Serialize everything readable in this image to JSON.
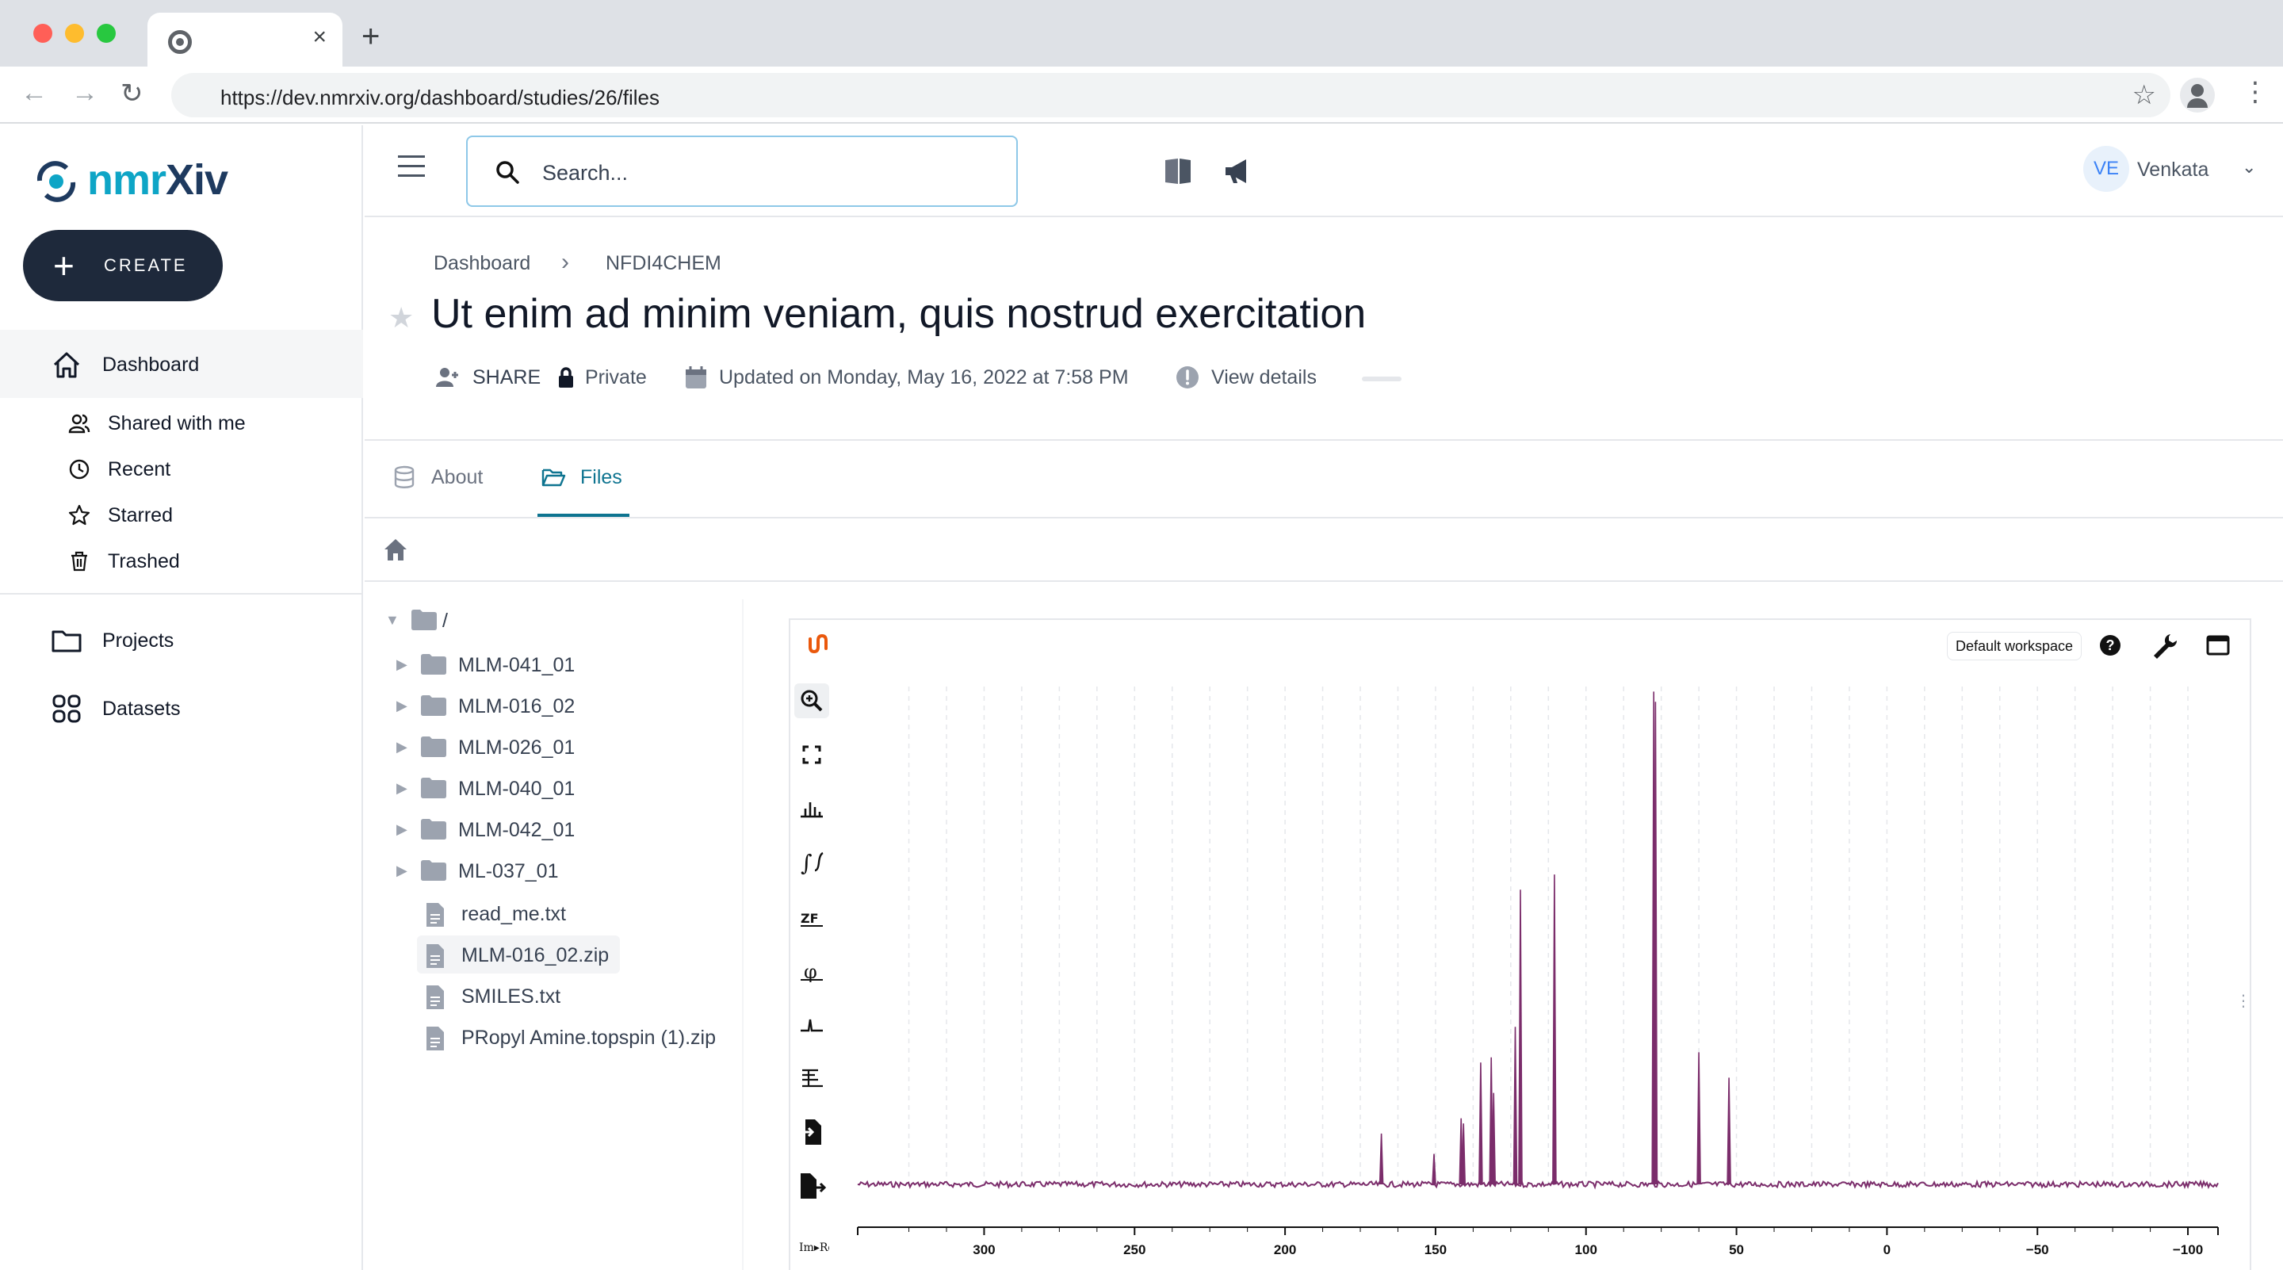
{
  "browser": {
    "url": "https://dev.nmrxiv.org/dashboard/studies/26/files",
    "close_tab": "×",
    "new_tab": "+",
    "back": "←",
    "forward": "→",
    "reload": "↻",
    "bookmark": "☆",
    "menu": "⋮"
  },
  "brand": {
    "logo_prefix": "nmr",
    "logo_suffix": "Xiv"
  },
  "sidebar": {
    "create_label": "CREATE",
    "create_icon": "+",
    "items": [
      {
        "label": "Dashboard",
        "icon": "home-icon",
        "active": true
      },
      {
        "label": "Shared with me",
        "icon": "users-icon"
      },
      {
        "label": "Recent",
        "icon": "clock-icon"
      },
      {
        "label": "Starred",
        "icon": "star-icon"
      },
      {
        "label": "Trashed",
        "icon": "trash-icon"
      },
      {
        "label": "Projects",
        "icon": "folder-icon"
      },
      {
        "label": "Datasets",
        "icon": "grid-icon"
      }
    ]
  },
  "header": {
    "search_placeholder": "Search...",
    "user_initials": "VE",
    "user_name": "Venkata",
    "user_chevron": "⌄"
  },
  "page": {
    "breadcrumb": [
      "Dashboard",
      "NFDI4CHEM"
    ],
    "breadcrumb_sep": "›",
    "star": "★",
    "title": "Ut enim ad minim veniam, quis nostrud exercitation",
    "share_label": "SHARE",
    "visibility": "Private",
    "updated": "Updated on Monday, May 16, 2022 at 7:58 PM",
    "view_details": "View details",
    "tabs": [
      {
        "label": "About",
        "icon": "database-icon",
        "active": false
      },
      {
        "label": "Files",
        "icon": "folder-open-icon",
        "active": true
      }
    ]
  },
  "file_tree": {
    "root": "/",
    "root_caret": "▼",
    "folder_caret": "▶",
    "folders": [
      "MLM-041_01",
      "MLM-016_02",
      "MLM-026_01",
      "MLM-040_01",
      "MLM-042_01",
      "ML-037_01"
    ],
    "files": [
      "read_me.txt",
      "MLM-016_02.zip",
      "SMILES.txt",
      "PRopyl Amine.topspin (1).zip"
    ],
    "selected": "MLM-016_02.zip"
  },
  "viewer": {
    "workspace_label": "Default workspace",
    "help_glyph": "?",
    "resize_handle": "⋮",
    "tools": [
      "zoom-icon",
      "fullscreen-icon",
      "peak-picking-icon",
      "integral-icon",
      "zero-filling-icon",
      "phase-correction-icon",
      "baseline-correction-icon",
      "range-picking-icon",
      "import-icon",
      "export-icon",
      "real-imaginary-icon"
    ],
    "tool_glyphs": [
      "ıl",
      "∫",
      "ZF",
      "φ",
      "⊥",
      "∫",
      "Im▸Re"
    ]
  },
  "chart_data": {
    "type": "line",
    "title": "",
    "xlabel": "",
    "ylabel": "",
    "x_reversed": true,
    "xlim": [
      342,
      -110
    ],
    "ylim": [
      0,
      100
    ],
    "x_ticks": [
      300,
      250,
      200,
      150,
      100,
      50,
      0,
      -50,
      -100
    ],
    "x_tick_labels": [
      "300",
      "250",
      "200",
      "150",
      "100",
      "50",
      "0",
      "−50",
      "−100"
    ],
    "grid": true,
    "series_color": "#7b2d6b",
    "baseline": 2,
    "peaks": [
      {
        "x": 168,
        "y": 12
      },
      {
        "x": 150.5,
        "y": 8
      },
      {
        "x": 141.5,
        "y": 15
      },
      {
        "x": 140.7,
        "y": 14
      },
      {
        "x": 135,
        "y": 26
      },
      {
        "x": 131.5,
        "y": 27
      },
      {
        "x": 130.7,
        "y": 20
      },
      {
        "x": 123.5,
        "y": 33
      },
      {
        "x": 121.8,
        "y": 60
      },
      {
        "x": 110.5,
        "y": 63
      },
      {
        "x": 77.5,
        "y": 99
      },
      {
        "x": 76.9,
        "y": 97
      },
      {
        "x": 62.5,
        "y": 28
      },
      {
        "x": 52.5,
        "y": 23
      }
    ]
  }
}
